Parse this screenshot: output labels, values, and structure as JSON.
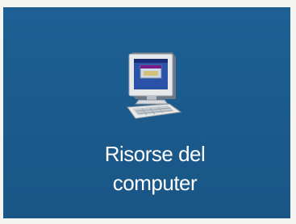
{
  "desktop": {
    "background_color": "#1c5c8e",
    "icon": {
      "name": "my-computer-icon",
      "label_line1": "Risorse del",
      "label_line2": "computer"
    }
  }
}
